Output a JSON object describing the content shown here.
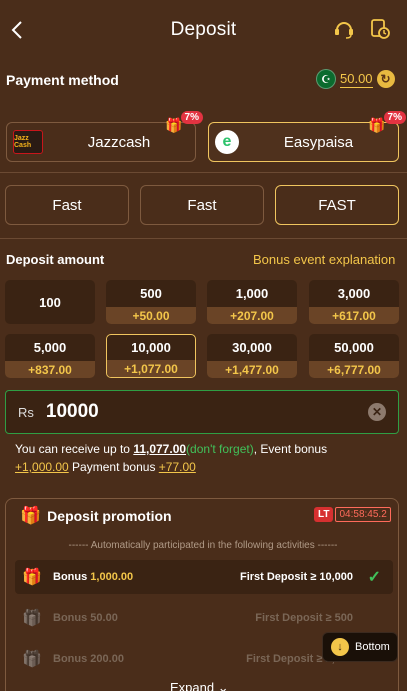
{
  "header": {
    "title": "Deposit"
  },
  "payment": {
    "label": "Payment method",
    "balance": "50.00",
    "methods": [
      {
        "name": "Jazzcash",
        "logo_text": "Jazz Cash",
        "promo": "7%",
        "selected": false
      },
      {
        "name": "Easypaisa",
        "logo_text": "e",
        "promo": "7%",
        "selected": true
      }
    ]
  },
  "channels": [
    {
      "label": "Fast",
      "selected": false
    },
    {
      "label": "Fast",
      "selected": false
    },
    {
      "label": "FAST",
      "selected": true
    }
  ],
  "deposit": {
    "label": "Deposit amount",
    "bonus_link": "Bonus event explanation",
    "amounts": [
      {
        "value": "100",
        "bonus": ""
      },
      {
        "value": "500",
        "bonus": "+50.00"
      },
      {
        "value": "1,000",
        "bonus": "+207.00"
      },
      {
        "value": "3,000",
        "bonus": "+617.00"
      },
      {
        "value": "5,000",
        "bonus": "+837.00"
      },
      {
        "value": "10,000",
        "bonus": "+1,077.00"
      },
      {
        "value": "30,000",
        "bonus": "+1,477.00"
      },
      {
        "value": "50,000",
        "bonus": "+6,777.00"
      }
    ],
    "currency": "Rs",
    "input_value": "10000",
    "receive": {
      "prefix": "You can receive up to ",
      "total": "11,077.00",
      "reminder": "(don't forget)",
      "event_label": ", Event bonus",
      "event_bonus": "+1,000.00",
      "payment_label": " Payment bonus ",
      "payment_bonus": "+77.00"
    }
  },
  "promotion": {
    "title": "Deposit promotion",
    "badge": "LT",
    "countdown": "04:58:45.2",
    "auto_text": "------ Automatically participated in the following activities ------",
    "rows": [
      {
        "bonus_label": "Bonus",
        "bonus_value": "1,000.00",
        "condition": "First Deposit ≥ 10,000",
        "active": true
      },
      {
        "bonus_label": "Bonus",
        "bonus_value": "50.00",
        "condition": "First Deposit ≥ 500",
        "active": false
      },
      {
        "bonus_label": "Bonus",
        "bonus_value": "200.00",
        "condition": "First Deposit ≥ 2,000",
        "active": false
      }
    ],
    "expand_label": "Expand"
  },
  "floating": {
    "bottom_label": "Bottom"
  }
}
